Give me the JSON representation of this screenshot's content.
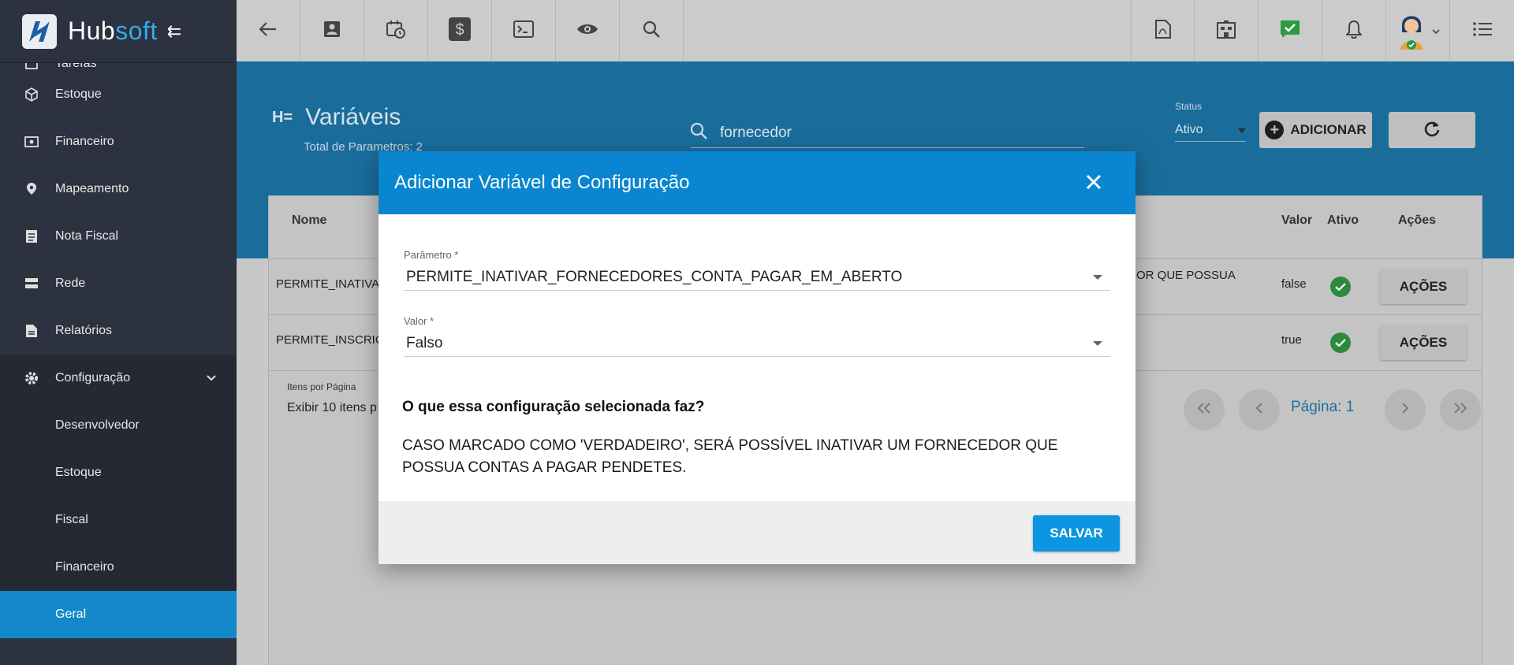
{
  "app": {
    "brand_part1": "Hub",
    "brand_part2": "soft"
  },
  "sidebar": {
    "items": [
      {
        "label": "Tarefas",
        "icon": "tasks-icon"
      },
      {
        "label": "Estoque",
        "icon": "box-icon"
      },
      {
        "label": "Financeiro",
        "icon": "money-icon"
      },
      {
        "label": "Mapeamento",
        "icon": "map-pin-icon"
      },
      {
        "label": "Nota Fiscal",
        "icon": "invoice-icon"
      },
      {
        "label": "Rede",
        "icon": "network-icon"
      },
      {
        "label": "Relatórios",
        "icon": "report-icon"
      },
      {
        "label": "Configuração",
        "icon": "gear-icon"
      }
    ],
    "subitems": [
      {
        "label": "Desenvolvedor"
      },
      {
        "label": "Estoque"
      },
      {
        "label": "Fiscal"
      },
      {
        "label": "Financeiro"
      },
      {
        "label": "Geral"
      }
    ]
  },
  "page": {
    "title": "Variáveis",
    "subtitle": "Total de Parametros: 2",
    "search_value": "fornecedor",
    "status_label": "Status",
    "status_value": "Ativo",
    "add_label": "ADICIONAR"
  },
  "table": {
    "headers": {
      "nome": "Nome",
      "valor": "Valor",
      "ativo": "Ativo",
      "acoes": "Ações"
    },
    "rows": [
      {
        "nome": "PERMITE_INATIVA",
        "desc_tail": "OR QUE POSSUA",
        "valor": "false",
        "acoes": "AÇÕES"
      },
      {
        "nome": "PERMITE_INSCRIC",
        "desc_tail": "",
        "valor": "true",
        "acoes": "AÇÕES"
      }
    ],
    "per_page_label": "Itens por Página",
    "per_page_value": "Exibir 10 itens p",
    "page_label": "Página: 1"
  },
  "modal": {
    "title": "Adicionar Variável de Configuração",
    "param_label": "Parâmetro *",
    "param_value": "PERMITE_INATIVAR_FORNECEDORES_CONTA_PAGAR_EM_ABERTO",
    "valor_label": "Valor *",
    "valor_value": "Falso",
    "question": "O que essa configuração selecionada faz?",
    "description": "CASO MARCADO COMO 'VERDADEIRO', SERÁ POSSÍVEL INATIVAR UM FORNECEDOR QUE POSSUA CONTAS A PAGAR PENDETES.",
    "save_label": "SALVAR"
  },
  "colors": {
    "accent": "#0a86d0",
    "sidebar_bg": "#2c323f",
    "active_item": "#1389c9",
    "check_green": "#2c8a3c"
  }
}
